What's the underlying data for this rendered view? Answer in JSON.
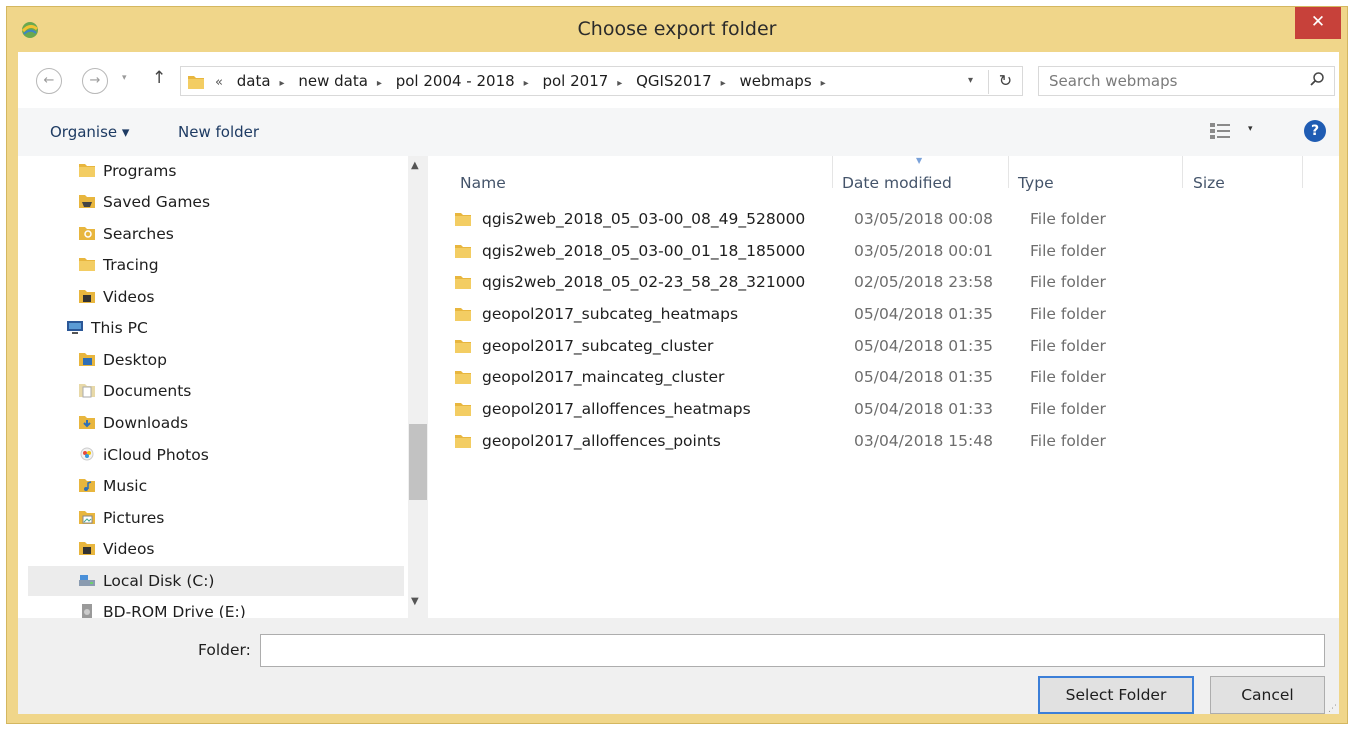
{
  "window": {
    "title": "Choose export folder",
    "close_glyph": "✕"
  },
  "nav": {
    "back_glyph": "←",
    "forward_glyph": "→",
    "up_glyph": "↑",
    "recent_glyph": "▾"
  },
  "address": {
    "overflow": "«",
    "crumbs": [
      "data",
      "new data",
      "pol 2004 - 2018",
      "pol 2017",
      "QGIS2017",
      "webmaps"
    ],
    "separator": "▸",
    "refresh_glyph": "↻"
  },
  "search": {
    "placeholder": "Search webmaps",
    "icon": "search-icon"
  },
  "toolbar": {
    "organise_label": "Organise ▾",
    "new_folder_label": "New folder",
    "help_glyph": "?"
  },
  "sidebar": {
    "items": [
      {
        "label": "Programs",
        "icon": "folder-icon"
      },
      {
        "label": "Saved Games",
        "icon": "saved-games-icon"
      },
      {
        "label": "Searches",
        "icon": "searches-icon"
      },
      {
        "label": "Tracing",
        "icon": "folder-icon"
      },
      {
        "label": "Videos",
        "icon": "videos-icon"
      },
      {
        "label": "This PC",
        "icon": "this-pc-icon"
      },
      {
        "label": "Desktop",
        "icon": "desktop-icon"
      },
      {
        "label": "Documents",
        "icon": "documents-icon"
      },
      {
        "label": "Downloads",
        "icon": "downloads-icon"
      },
      {
        "label": "iCloud Photos",
        "icon": "icloud-photos-icon"
      },
      {
        "label": "Music",
        "icon": "music-icon"
      },
      {
        "label": "Pictures",
        "icon": "pictures-icon"
      },
      {
        "label": "Videos",
        "icon": "videos-icon"
      },
      {
        "label": "Local Disk (C:)",
        "icon": "local-disk-icon"
      },
      {
        "label": "BD-ROM Drive (E:)",
        "icon": "bd-rom-drive-icon"
      }
    ]
  },
  "filelist": {
    "columns": [
      "Name",
      "Date modified",
      "Type",
      "Size"
    ],
    "rows": [
      {
        "name": "qgis2web_2018_05_03-00_08_49_528000",
        "date": "03/05/2018 00:08",
        "type": "File folder"
      },
      {
        "name": "qgis2web_2018_05_03-00_01_18_185000",
        "date": "03/05/2018 00:01",
        "type": "File folder"
      },
      {
        "name": "qgis2web_2018_05_02-23_58_28_321000",
        "date": "02/05/2018 23:58",
        "type": "File folder"
      },
      {
        "name": "geopol2017_subcateg_heatmaps",
        "date": "05/04/2018 01:35",
        "type": "File folder"
      },
      {
        "name": "geopol2017_subcateg_cluster",
        "date": "05/04/2018 01:35",
        "type": "File folder"
      },
      {
        "name": "geopol2017_maincateg_cluster",
        "date": "05/04/2018 01:35",
        "type": "File folder"
      },
      {
        "name": "geopol2017_alloffences_heatmaps",
        "date": "05/04/2018 01:33",
        "type": "File folder"
      },
      {
        "name": "geopol2017_alloffences_points",
        "date": "03/04/2018 15:48",
        "type": "File folder"
      }
    ]
  },
  "footer": {
    "folder_label": "Folder:",
    "folder_value": "",
    "select_button": "Select Folder",
    "cancel_button": "Cancel"
  },
  "colors": {
    "frame": "#f0d68a",
    "close": "#c7413a",
    "accent": "#3c7fd8",
    "folder": "#e8b63e"
  }
}
